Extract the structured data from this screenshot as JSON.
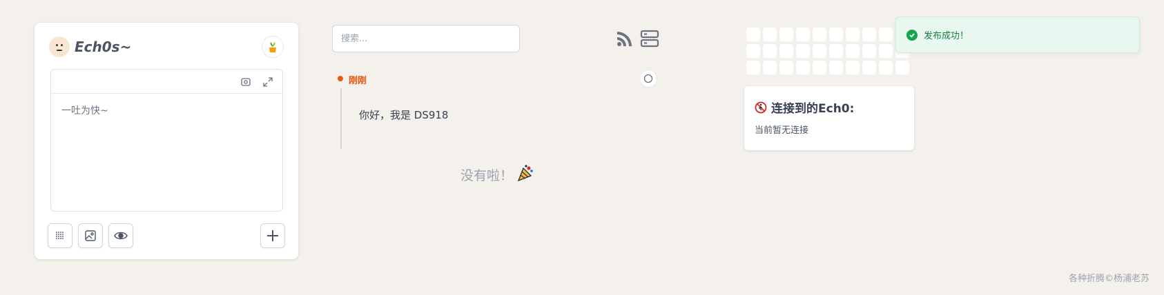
{
  "brand": {
    "name": "Ech0s~"
  },
  "editor": {
    "placeholder": "一吐为快~"
  },
  "search": {
    "placeholder": "搜索..."
  },
  "timeline": {
    "items": [
      {
        "time": "刚刚",
        "content": "你好，我是 DS918"
      }
    ],
    "end_text": "没有啦！"
  },
  "toast": {
    "message": "发布成功！"
  },
  "connect": {
    "title": "连接到的Ech0:",
    "status": "当前暂无连接"
  },
  "footer": {
    "text": "各种折腾©杨浦老苏"
  },
  "colors": {
    "background": "#f4f1ec",
    "accent": "#ea580c",
    "success": "#16a34a"
  }
}
